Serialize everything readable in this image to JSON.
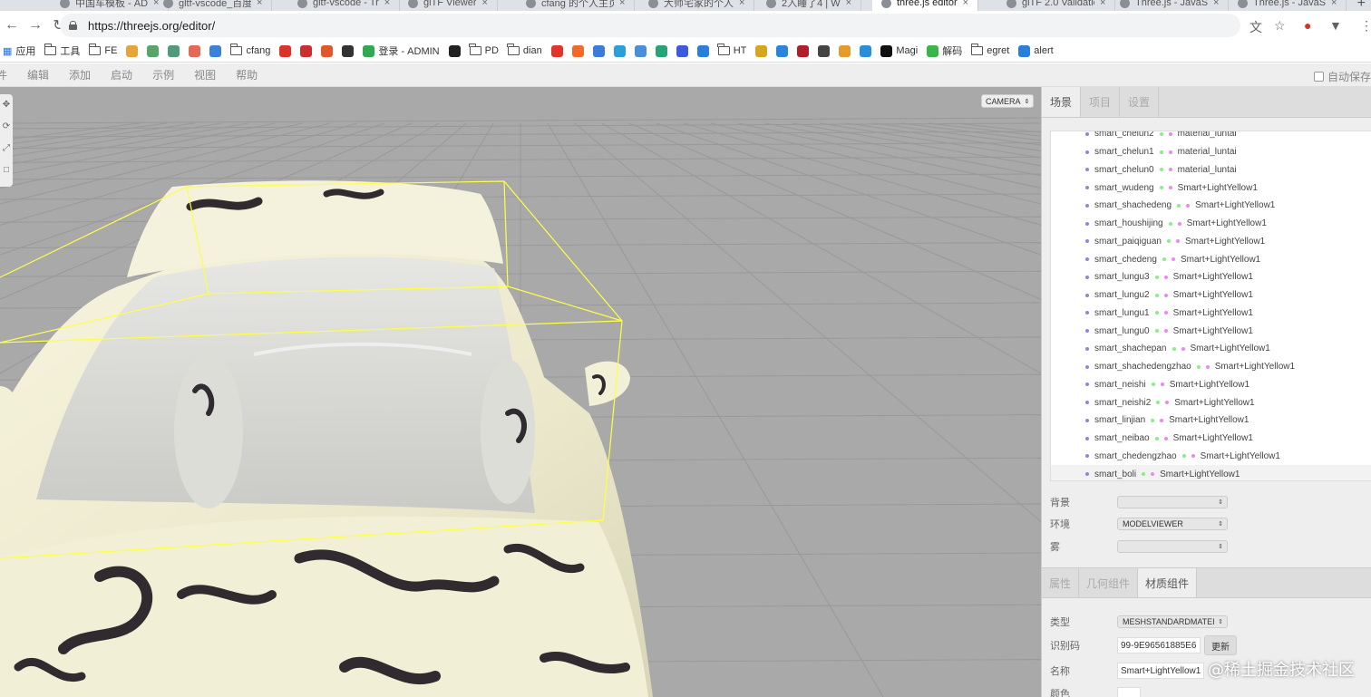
{
  "browser": {
    "tabs": [
      {
        "title": "中国车模板 - AD",
        "active": false
      },
      {
        "title": "gltf-vscode_百度",
        "active": false
      },
      {
        "title": "gltf-vscode - Tr",
        "active": false
      },
      {
        "title": "glTF Viewer",
        "active": false
      },
      {
        "title": "cfang 的个人主页",
        "active": false
      },
      {
        "title": "大师宅家的个人",
        "active": false
      },
      {
        "title": "2入睡了4 | W",
        "active": false
      },
      {
        "title": "three.js editor",
        "active": true
      },
      {
        "title": "glTF 2.0 Validatio",
        "active": false
      },
      {
        "title": "Three.js - JavaSc",
        "active": false
      },
      {
        "title": "Three.js - JavaSc",
        "active": false
      }
    ],
    "url": "https://threejs.org/editor/",
    "bookmarks": [
      {
        "label": "应用",
        "icon": "apps-grid-icon"
      },
      {
        "label": "工具",
        "icon": "folder-icon"
      },
      {
        "label": "FE",
        "icon": "folder-icon"
      },
      {
        "label": "",
        "icon": "bookmark-icon-1",
        "color": "#e8a33a"
      },
      {
        "label": "",
        "icon": "bookmark-icon-2",
        "color": "#5aa469"
      },
      {
        "label": "",
        "icon": "bookmark-icon-3",
        "color": "#4f9b7b"
      },
      {
        "label": "",
        "icon": "bookmark-icon-4",
        "color": "#e36a56"
      },
      {
        "label": "",
        "icon": "bookmark-icon-5",
        "color": "#3b83d6"
      },
      {
        "label": "cfang",
        "icon": "folder-icon"
      },
      {
        "label": "",
        "icon": "bookmark-icon-6",
        "color": "#d9342b"
      },
      {
        "label": "",
        "icon": "bookmark-icon-7",
        "color": "#c9302c"
      },
      {
        "label": "",
        "icon": "bookmark-icon-8",
        "color": "#e0572c"
      },
      {
        "label": "",
        "icon": "bookmark-icon-9",
        "color": "#333333"
      },
      {
        "label": "登录 - ADMIN",
        "icon": "bookmark-icon-10",
        "color": "#32a852"
      },
      {
        "label": "",
        "icon": "github-icon",
        "color": "#222222"
      },
      {
        "label": "PD",
        "icon": "folder-icon"
      },
      {
        "label": "dian",
        "icon": "folder-icon"
      },
      {
        "label": "",
        "icon": "bookmark-icon-11",
        "color": "#e0352b"
      },
      {
        "label": "",
        "icon": "bookmark-icon-12",
        "color": "#f06a2c"
      },
      {
        "label": "",
        "icon": "bookmark-icon-13",
        "color": "#3d7bd9"
      },
      {
        "label": "",
        "icon": "bookmark-icon-14",
        "color": "#2d9fd8"
      },
      {
        "label": "",
        "icon": "bookmark-icon-15",
        "color": "#4a8fd8"
      },
      {
        "label": "",
        "icon": "bookmark-icon-16",
        "color": "#27a37a"
      },
      {
        "label": "",
        "icon": "bookmark-icon-17",
        "color": "#3b5bdb"
      },
      {
        "label": "",
        "icon": "bookmark-icon-18",
        "color": "#2b7fd8"
      },
      {
        "label": "HT",
        "icon": "folder-icon"
      },
      {
        "label": "",
        "icon": "bookmark-icon-19",
        "color": "#d8a51f"
      },
      {
        "label": "",
        "icon": "bookmark-icon-20",
        "color": "#2a86d8"
      },
      {
        "label": "",
        "icon": "bookmark-icon-21",
        "color": "#b01f2a"
      },
      {
        "label": "",
        "icon": "bookmark-icon-22",
        "color": "#444444"
      },
      {
        "label": "",
        "icon": "bookmark-icon-23",
        "color": "#e59b2b"
      },
      {
        "label": "",
        "icon": "bookmark-icon-24",
        "color": "#2b8fd8"
      },
      {
        "label": "Magi",
        "icon": "bookmark-icon-25",
        "color": "#111111"
      },
      {
        "label": "解码",
        "icon": "bookmark-icon-26",
        "color": "#3bb54a"
      },
      {
        "label": "egret",
        "icon": "folder-icon"
      },
      {
        "label": "alert",
        "icon": "bookmark-icon-27",
        "color": "#2b7fd8"
      }
    ]
  },
  "editor": {
    "menus": [
      "件",
      "编辑",
      "添加",
      "启动",
      "示例",
      "视图",
      "帮助"
    ],
    "autosave_label": "自动保存",
    "camera_label": "CAMERA",
    "sidebar_tabs": [
      "场景",
      "项目",
      "设置"
    ],
    "outliner": [
      {
        "name": "smart_chelun2",
        "material": "material_luntai"
      },
      {
        "name": "smart_chelun1",
        "material": "material_luntai"
      },
      {
        "name": "smart_chelun0",
        "material": "material_luntai"
      },
      {
        "name": "smart_wudeng",
        "material": "Smart+LightYellow1"
      },
      {
        "name": "smart_shachedeng",
        "material": "Smart+LightYellow1"
      },
      {
        "name": "smart_houshijing",
        "material": "Smart+LightYellow1"
      },
      {
        "name": "smart_paiqiguan",
        "material": "Smart+LightYellow1"
      },
      {
        "name": "smart_chedeng",
        "material": "Smart+LightYellow1"
      },
      {
        "name": "smart_lungu3",
        "material": "Smart+LightYellow1"
      },
      {
        "name": "smart_lungu2",
        "material": "Smart+LightYellow1"
      },
      {
        "name": "smart_lungu1",
        "material": "Smart+LightYellow1"
      },
      {
        "name": "smart_lungu0",
        "material": "Smart+LightYellow1"
      },
      {
        "name": "smart_shachepan",
        "material": "Smart+LightYellow1"
      },
      {
        "name": "smart_shachedengzhao",
        "material": "Smart+LightYellow1"
      },
      {
        "name": "smart_neishi",
        "material": "Smart+LightYellow1"
      },
      {
        "name": "smart_neishi2",
        "material": "Smart+LightYellow1"
      },
      {
        "name": "smart_linjian",
        "material": "Smart+LightYellow1"
      },
      {
        "name": "smart_neibao",
        "material": "Smart+LightYellow1"
      },
      {
        "name": "smart_chedengzhao",
        "material": "Smart+LightYellow1"
      },
      {
        "name": "smart_boli",
        "material": "Smart+LightYellow1"
      }
    ],
    "scene_props": {
      "background_label": "背景",
      "background_value": "",
      "environment_label": "环境",
      "environment_value": "MODELVIEWER",
      "fog_label": "雾",
      "fog_value": ""
    },
    "prop_tabs": [
      "属性",
      "几何组件",
      "材质组件"
    ],
    "material": {
      "type_label": "类型",
      "type_value": "MESHSTANDARDMATEI",
      "uuid_label": "识别码",
      "uuid_value": "99-9E96561885E6",
      "update_button": "更新",
      "name_label": "名称",
      "name_value": "Smart+LightYellow1",
      "color_label": "颜色"
    }
  },
  "watermark": "@稀土掘金技术社区",
  "colors": {
    "viewport_bg": "#aaaaaa",
    "selection_box": "#ffff44",
    "car_body": "#f3f0d8",
    "grid_line": "#999999"
  }
}
